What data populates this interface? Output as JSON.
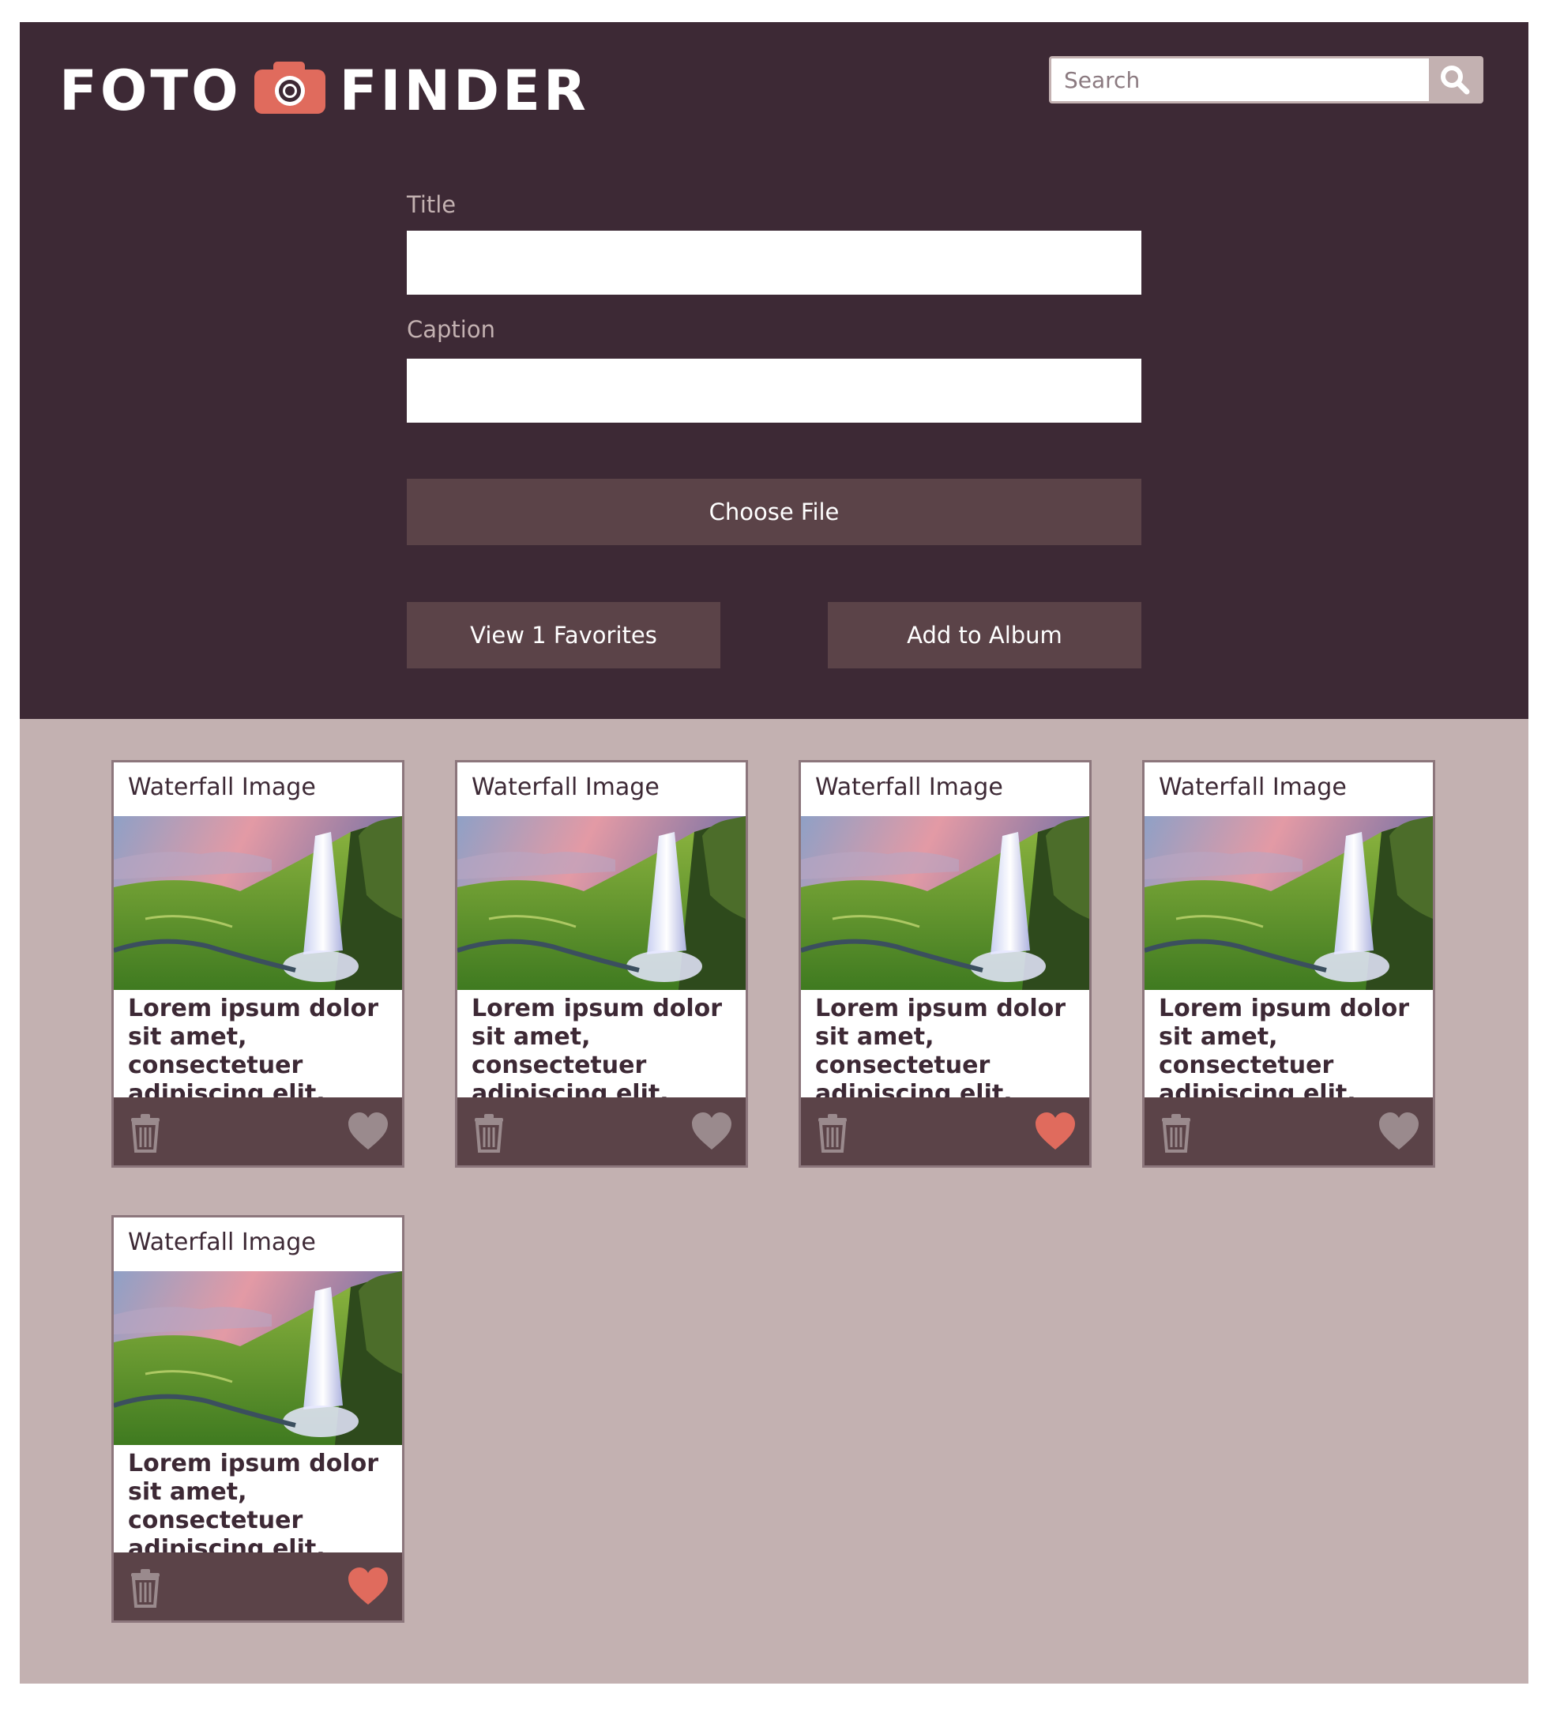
{
  "app": {
    "brand_left": "FOTO",
    "brand_right": "FINDER"
  },
  "search": {
    "placeholder": "Search"
  },
  "form": {
    "title_label": "Title",
    "caption_label": "Caption",
    "choose_file_label": "Choose File",
    "view_favorites_label": "View 1 Favorites",
    "add_to_album_label": "Add to Album"
  },
  "cards": [
    {
      "title": "Waterfall Image",
      "caption": "Lorem ipsum dolor sit amet, consectetuer adipiscing elit.",
      "favorited": false
    },
    {
      "title": "Waterfall Image",
      "caption": "Lorem ipsum dolor sit amet, consectetuer adipiscing elit.",
      "favorited": false
    },
    {
      "title": "Waterfall Image",
      "caption": "Lorem ipsum dolor sit amet, consectetuer adipiscing elit.",
      "favorited": true
    },
    {
      "title": "Waterfall Image",
      "caption": "Lorem ipsum dolor sit amet, consectetuer adipiscing elit.",
      "favorited": false
    },
    {
      "title": "Waterfall Image",
      "caption": "Lorem ipsum dolor sit amet, consectetuer adipiscing elit.",
      "favorited": true
    }
  ],
  "icons": {
    "camera": "camera-icon",
    "search": "search-icon",
    "trash": "trash-icon",
    "heart": "heart-icon"
  },
  "colors": {
    "header_bg": "#3d2935",
    "body_bg": "#c3b1b1",
    "button_bg": "#5b4348",
    "accent": "#e06b5d",
    "heart_inactive": "#9a8a8d"
  }
}
